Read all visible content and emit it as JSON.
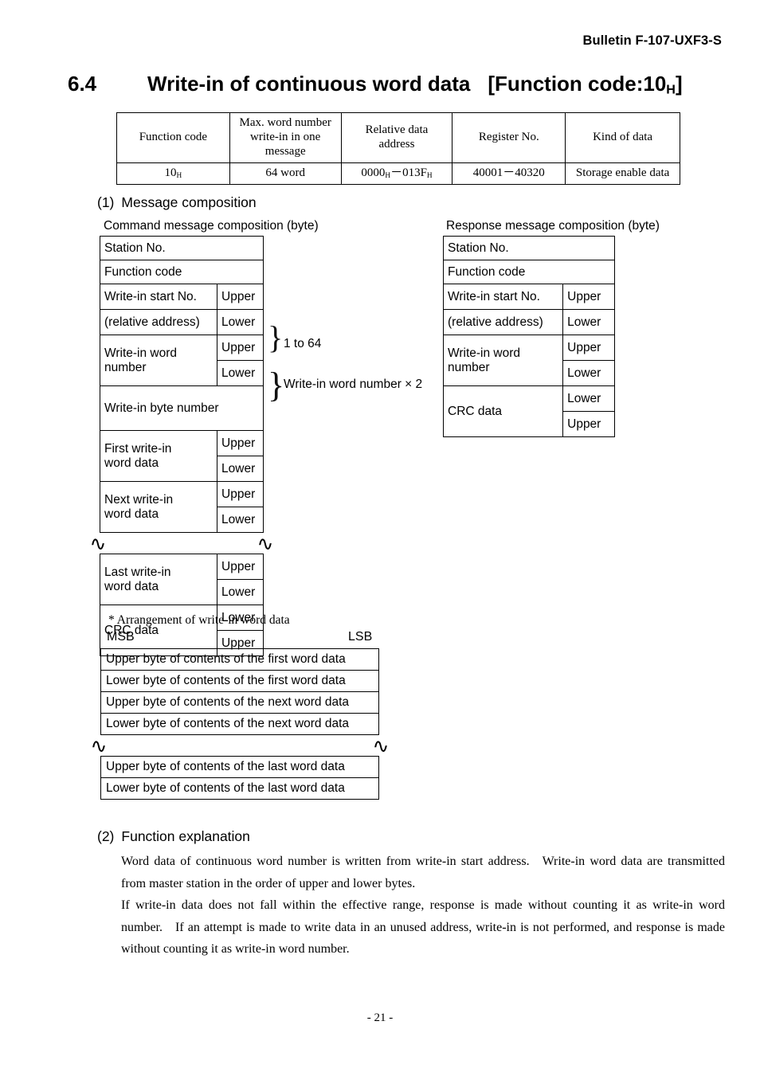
{
  "header": {
    "bulletin": "Bulletin F-107-UXF3-S"
  },
  "title": {
    "number": "6.4",
    "text": "Write-in of continuous word data",
    "function_code_prefix": "[Function code:10",
    "function_code_sub": "H",
    "function_code_suffix": "]"
  },
  "spec_table": {
    "headers": [
      "Function code",
      "Max. word number write-in in one message",
      "Relative data address",
      "Register No.",
      "Kind of data"
    ],
    "header_lines": {
      "h2_l1": "Max. word number",
      "h2_l2": "write-in in one",
      "h2_l3": "message",
      "h3_l1": "Relative data",
      "h3_l2": "address"
    },
    "row": {
      "function_code_val": "10",
      "function_code_sub": "H",
      "max_word": "64 word",
      "rel_addr_a": "0000",
      "rel_addr_a_sub": "H",
      "rel_addr_dash": "－",
      "rel_addr_b": "013F",
      "rel_addr_b_sub": "H",
      "register_no": "40001－40320",
      "kind_of_data": "Storage enable data"
    }
  },
  "section1": {
    "number": "(1)",
    "label": "Message composition",
    "command_caption": "Command message composition (byte)",
    "response_caption": "Response message composition (byte)"
  },
  "command_table": {
    "rows": [
      {
        "label": "Station No.",
        "side": null
      },
      {
        "label": "Function code",
        "side": null
      },
      {
        "label": "Write-in start No.",
        "side": "Upper"
      },
      {
        "label": "(relative address)",
        "side": "Lower"
      },
      {
        "label": "Write-in word",
        "side": "Upper"
      },
      {
        "label": "number",
        "side": "Lower"
      },
      {
        "label": "Write-in byte number",
        "side": null
      },
      {
        "label": "First write-in",
        "side": "Upper"
      },
      {
        "label": "word data",
        "side": "Lower"
      },
      {
        "label": "Next write-in",
        "side": "Upper"
      },
      {
        "label": "word data",
        "side": "Lower"
      },
      {
        "label": "break",
        "side": null
      },
      {
        "label": "Last write-in",
        "side": "Upper"
      },
      {
        "label": "word data",
        "side": "Lower"
      },
      {
        "label": "CRC data",
        "side": "Lower"
      },
      {
        "label": "",
        "side": "Upper"
      }
    ],
    "labels": {
      "station_no": "Station No.",
      "function_code": "Function code",
      "write_in_start_no": "Write-in start No.",
      "relative_address": "(relative address)",
      "write_in_word_1": "Write-in word",
      "write_in_word_2": "number",
      "write_in_byte_number": "Write-in byte number",
      "first_write_in_1": "First write-in",
      "first_write_in_2": "word data",
      "next_write_in_1": "Next write-in",
      "next_write_in_2": "word data",
      "last_write_in_1": "Last write-in",
      "last_write_in_2": "word data",
      "crc_data": "CRC data",
      "upper": "Upper",
      "lower": "Lower",
      "break_mark": "∿"
    },
    "annotations": {
      "one_to_64": "1 to 64",
      "word_times_two": "Write-in word number × 2"
    }
  },
  "response_table": {
    "labels": {
      "station_no": "Station No.",
      "function_code": "Function code",
      "write_in_start_no": "Write-in start No.",
      "relative_address": "(relative address)",
      "write_in_word_1": "Write-in word",
      "write_in_word_2": "number",
      "crc_data": "CRC data",
      "upper": "Upper",
      "lower": "Lower"
    }
  },
  "arrangement": {
    "caption": "* Arrangement of write-in word data",
    "msb": "MSB",
    "lsb": "LSB",
    "rows": [
      "Upper byte of contents of the first word data",
      "Lower byte of contents of the first word data",
      "Upper byte of contents of the next word data",
      "Lower byte of contents of the next word data",
      "",
      "Upper byte of contents of the last word data",
      "Lower byte of contents of the last word data"
    ]
  },
  "section2": {
    "number": "(2)",
    "label": "Function explanation",
    "paragraph1": "Word data of continuous word number is written from write-in start address. Write-in word data are transmitted from master station in the order of upper and lower bytes.",
    "paragraph2": "If write-in data does not fall within the effective range, response is made without counting it as write-in word number. If an attempt is made to write data in an unused address, write-in is not performed, and response is made without counting it as write-in word number."
  },
  "footer": {
    "page_number": "- 21 -"
  }
}
